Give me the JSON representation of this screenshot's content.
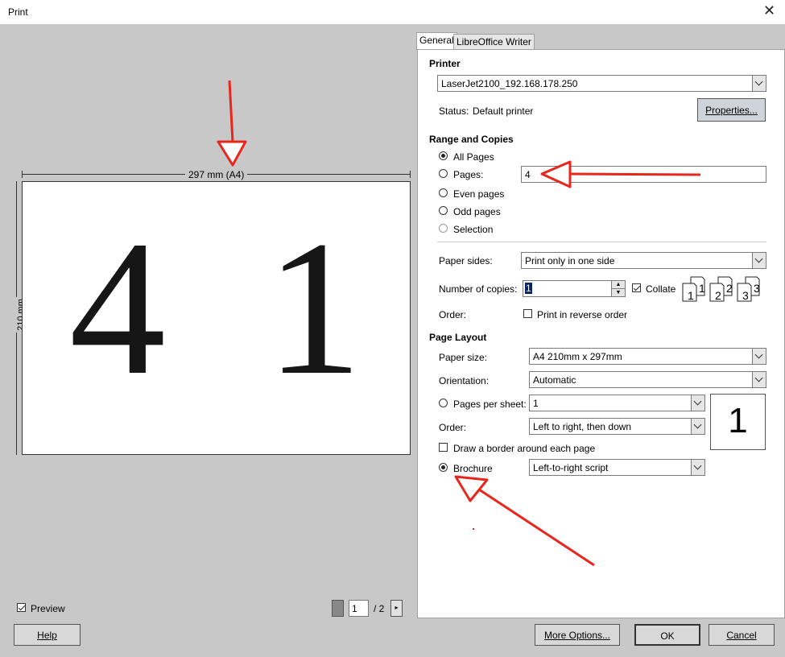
{
  "window": {
    "title": "Print",
    "close_icon": "close-icon"
  },
  "preview": {
    "width_label": "297 mm (A4)",
    "height_label": "210 mm",
    "page_left_number": "4",
    "page_right_number": "1",
    "preview_label": "Preview",
    "preview_checked": true,
    "page_input": "1",
    "page_total": "/ 2"
  },
  "tabs": [
    {
      "label": "General"
    },
    {
      "label": "LibreOffice Writer"
    }
  ],
  "printer": {
    "section": "Printer",
    "selected": "LaserJet2100_192.168.178.250",
    "status_label": "Status:",
    "status_value": "Default printer",
    "properties_button": "Properties..."
  },
  "range": {
    "section": "Range and Copies",
    "all_pages": "All Pages",
    "pages": "Pages:",
    "pages_value": "4",
    "even_pages": "Even pages",
    "odd_pages": "Odd pages",
    "selection": "Selection",
    "paper_sides_label": "Paper sides:",
    "paper_sides_value": "Print only in one side",
    "copies_label": "Number of copies:",
    "copies_value": "1",
    "collate_label": "Collate",
    "order_label": "Order:",
    "reverse_label": "Print in reverse order"
  },
  "layout": {
    "section": "Page Layout",
    "paper_size_label": "Paper size:",
    "paper_size_value": "A4 210mm x 297mm",
    "orientation_label": "Orientation:",
    "orientation_value": "Automatic",
    "pages_per_sheet_label": "Pages per sheet:",
    "pages_per_sheet_value": "1",
    "order_label": "Order:",
    "order_value": "Left to right, then down",
    "border_label": "Draw a border around each page",
    "brochure_label": "Brochure",
    "brochure_value": "Left-to-right script",
    "preview_number": "1"
  },
  "buttons": {
    "help": "Help",
    "more_options": "More Options...",
    "ok": "OK",
    "cancel": "Cancel"
  },
  "annotation_color": "#e8261c"
}
